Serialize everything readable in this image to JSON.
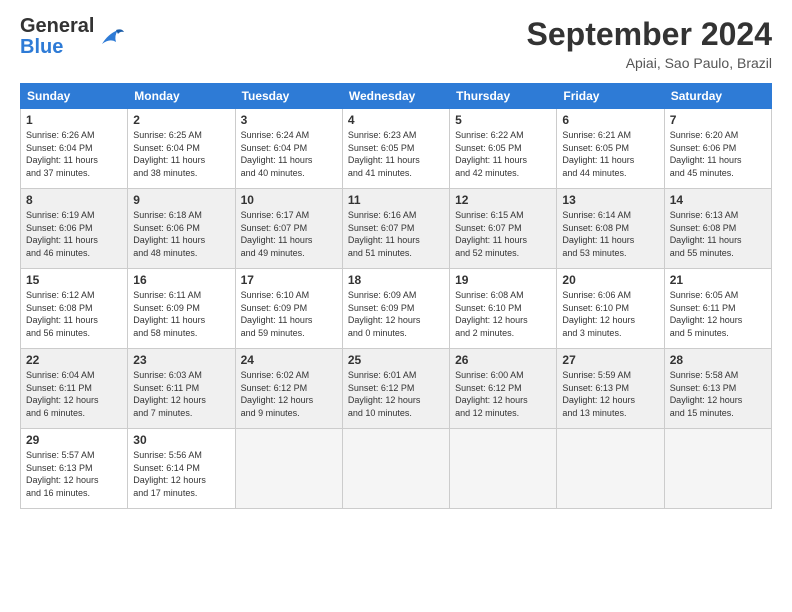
{
  "header": {
    "logo": {
      "general": "General",
      "blue": "Blue"
    },
    "title": "September 2024",
    "location": "Apiai, Sao Paulo, Brazil"
  },
  "days_of_week": [
    "Sunday",
    "Monday",
    "Tuesday",
    "Wednesday",
    "Thursday",
    "Friday",
    "Saturday"
  ],
  "weeks": [
    {
      "shaded": false,
      "days": [
        {
          "num": "1",
          "info": "Sunrise: 6:26 AM\nSunset: 6:04 PM\nDaylight: 11 hours\nand 37 minutes."
        },
        {
          "num": "2",
          "info": "Sunrise: 6:25 AM\nSunset: 6:04 PM\nDaylight: 11 hours\nand 38 minutes."
        },
        {
          "num": "3",
          "info": "Sunrise: 6:24 AM\nSunset: 6:04 PM\nDaylight: 11 hours\nand 40 minutes."
        },
        {
          "num": "4",
          "info": "Sunrise: 6:23 AM\nSunset: 6:05 PM\nDaylight: 11 hours\nand 41 minutes."
        },
        {
          "num": "5",
          "info": "Sunrise: 6:22 AM\nSunset: 6:05 PM\nDaylight: 11 hours\nand 42 minutes."
        },
        {
          "num": "6",
          "info": "Sunrise: 6:21 AM\nSunset: 6:05 PM\nDaylight: 11 hours\nand 44 minutes."
        },
        {
          "num": "7",
          "info": "Sunrise: 6:20 AM\nSunset: 6:06 PM\nDaylight: 11 hours\nand 45 minutes."
        }
      ]
    },
    {
      "shaded": true,
      "days": [
        {
          "num": "8",
          "info": "Sunrise: 6:19 AM\nSunset: 6:06 PM\nDaylight: 11 hours\nand 46 minutes."
        },
        {
          "num": "9",
          "info": "Sunrise: 6:18 AM\nSunset: 6:06 PM\nDaylight: 11 hours\nand 48 minutes."
        },
        {
          "num": "10",
          "info": "Sunrise: 6:17 AM\nSunset: 6:07 PM\nDaylight: 11 hours\nand 49 minutes."
        },
        {
          "num": "11",
          "info": "Sunrise: 6:16 AM\nSunset: 6:07 PM\nDaylight: 11 hours\nand 51 minutes."
        },
        {
          "num": "12",
          "info": "Sunrise: 6:15 AM\nSunset: 6:07 PM\nDaylight: 11 hours\nand 52 minutes."
        },
        {
          "num": "13",
          "info": "Sunrise: 6:14 AM\nSunset: 6:08 PM\nDaylight: 11 hours\nand 53 minutes."
        },
        {
          "num": "14",
          "info": "Sunrise: 6:13 AM\nSunset: 6:08 PM\nDaylight: 11 hours\nand 55 minutes."
        }
      ]
    },
    {
      "shaded": false,
      "days": [
        {
          "num": "15",
          "info": "Sunrise: 6:12 AM\nSunset: 6:08 PM\nDaylight: 11 hours\nand 56 minutes."
        },
        {
          "num": "16",
          "info": "Sunrise: 6:11 AM\nSunset: 6:09 PM\nDaylight: 11 hours\nand 58 minutes."
        },
        {
          "num": "17",
          "info": "Sunrise: 6:10 AM\nSunset: 6:09 PM\nDaylight: 11 hours\nand 59 minutes."
        },
        {
          "num": "18",
          "info": "Sunrise: 6:09 AM\nSunset: 6:09 PM\nDaylight: 12 hours\nand 0 minutes."
        },
        {
          "num": "19",
          "info": "Sunrise: 6:08 AM\nSunset: 6:10 PM\nDaylight: 12 hours\nand 2 minutes."
        },
        {
          "num": "20",
          "info": "Sunrise: 6:06 AM\nSunset: 6:10 PM\nDaylight: 12 hours\nand 3 minutes."
        },
        {
          "num": "21",
          "info": "Sunrise: 6:05 AM\nSunset: 6:11 PM\nDaylight: 12 hours\nand 5 minutes."
        }
      ]
    },
    {
      "shaded": true,
      "days": [
        {
          "num": "22",
          "info": "Sunrise: 6:04 AM\nSunset: 6:11 PM\nDaylight: 12 hours\nand 6 minutes."
        },
        {
          "num": "23",
          "info": "Sunrise: 6:03 AM\nSunset: 6:11 PM\nDaylight: 12 hours\nand 7 minutes."
        },
        {
          "num": "24",
          "info": "Sunrise: 6:02 AM\nSunset: 6:12 PM\nDaylight: 12 hours\nand 9 minutes."
        },
        {
          "num": "25",
          "info": "Sunrise: 6:01 AM\nSunset: 6:12 PM\nDaylight: 12 hours\nand 10 minutes."
        },
        {
          "num": "26",
          "info": "Sunrise: 6:00 AM\nSunset: 6:12 PM\nDaylight: 12 hours\nand 12 minutes."
        },
        {
          "num": "27",
          "info": "Sunrise: 5:59 AM\nSunset: 6:13 PM\nDaylight: 12 hours\nand 13 minutes."
        },
        {
          "num": "28",
          "info": "Sunrise: 5:58 AM\nSunset: 6:13 PM\nDaylight: 12 hours\nand 15 minutes."
        }
      ]
    },
    {
      "shaded": false,
      "days": [
        {
          "num": "29",
          "info": "Sunrise: 5:57 AM\nSunset: 6:13 PM\nDaylight: 12 hours\nand 16 minutes."
        },
        {
          "num": "30",
          "info": "Sunrise: 5:56 AM\nSunset: 6:14 PM\nDaylight: 12 hours\nand 17 minutes."
        },
        {
          "num": "",
          "info": ""
        },
        {
          "num": "",
          "info": ""
        },
        {
          "num": "",
          "info": ""
        },
        {
          "num": "",
          "info": ""
        },
        {
          "num": "",
          "info": ""
        }
      ]
    }
  ]
}
